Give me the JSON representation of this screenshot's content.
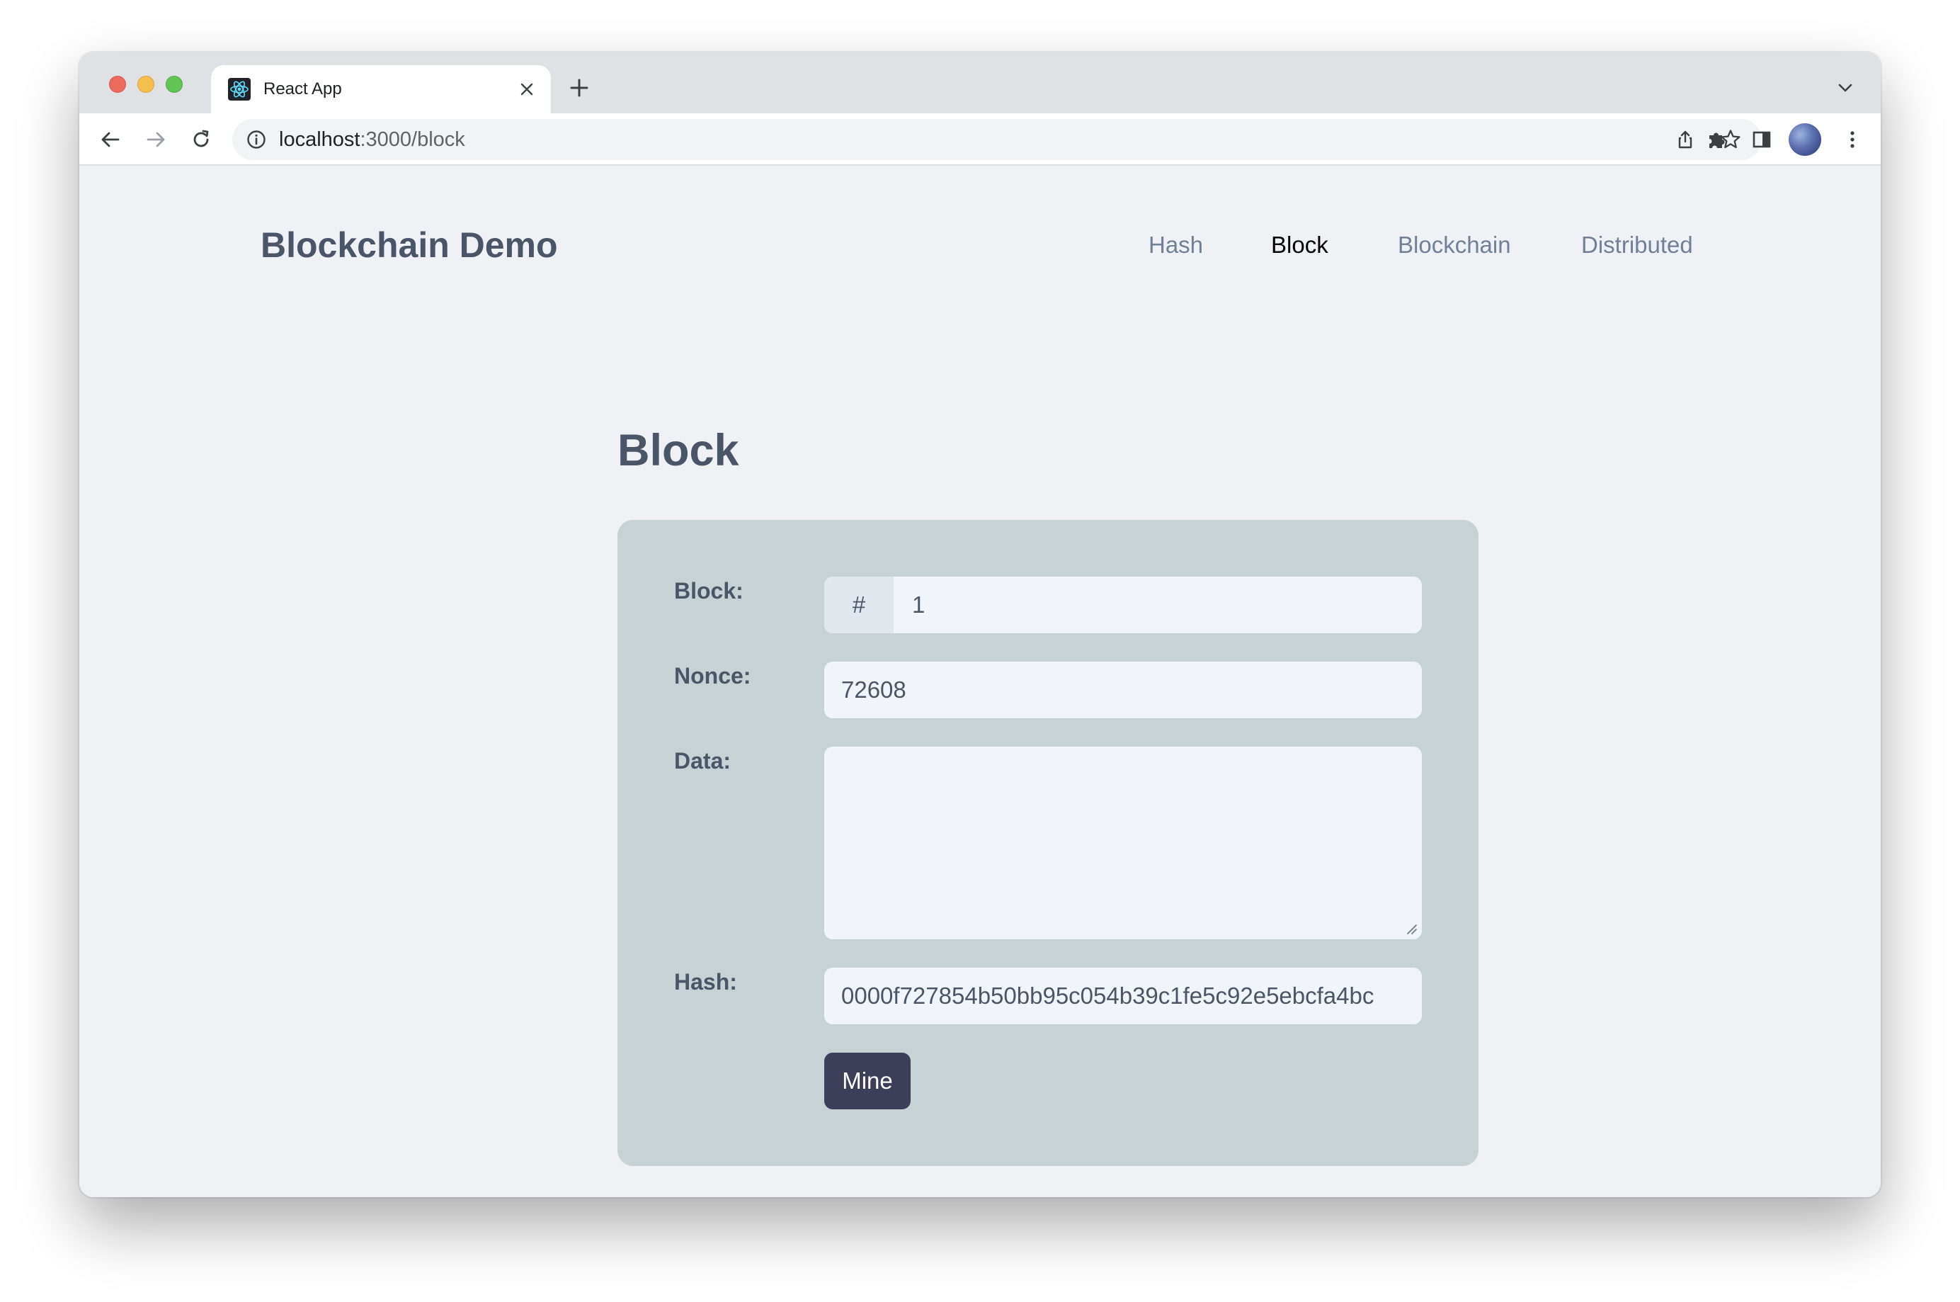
{
  "browser": {
    "tab_title": "React App",
    "url_host": "localhost",
    "url_path": ":3000/block"
  },
  "app": {
    "brand": "Blockchain Demo",
    "nav": [
      {
        "label": "Hash"
      },
      {
        "label": "Block",
        "active": true
      },
      {
        "label": "Blockchain"
      },
      {
        "label": "Distributed"
      }
    ]
  },
  "main": {
    "title": "Block",
    "form": {
      "block_label": "Block:",
      "block_prefix": "#",
      "block_value": "1",
      "nonce_label": "Nonce:",
      "nonce_value": "72608",
      "data_label": "Data:",
      "data_value": "",
      "hash_label": "Hash:",
      "hash_value": "0000f727854b50bb95c054b39c1fe5c92e5ebcfa4bc",
      "mine_label": "Mine"
    }
  },
  "colors": {
    "card_bg": "#c6d2d3",
    "button_bg": "#3d3e5a",
    "page_bg": "#eff1f5",
    "text": "#4a5568"
  },
  "icons": [
    "react-favicon-icon",
    "close-icon",
    "plus-icon",
    "chevron-down-icon",
    "back-arrow-icon",
    "forward-arrow-icon",
    "reload-icon",
    "info-icon",
    "share-icon",
    "star-icon",
    "puzzle-icon",
    "side-panel-icon",
    "kebab-menu-icon"
  ]
}
